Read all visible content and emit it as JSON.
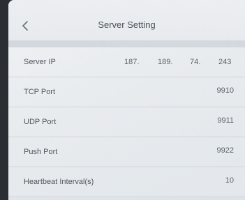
{
  "header": {
    "title": "Server Setting",
    "back_icon": "chevron-left-icon"
  },
  "server_ip": {
    "label": "Server IP",
    "octet1": "187.",
    "octet2": "189.",
    "octet3": "74.",
    "octet4": "243"
  },
  "tcp_port": {
    "label": "TCP Port",
    "value": "9910"
  },
  "udp_port": {
    "label": "UDP Port",
    "value": "9911"
  },
  "push_port": {
    "label": "Push Port",
    "value": "9922"
  },
  "heartbeat": {
    "label": "Heartbeat Interval(s)",
    "value": "10"
  },
  "colors": {
    "background": "#e7eaee",
    "divider_band": "#d3d8de",
    "text": "#4c525a"
  }
}
